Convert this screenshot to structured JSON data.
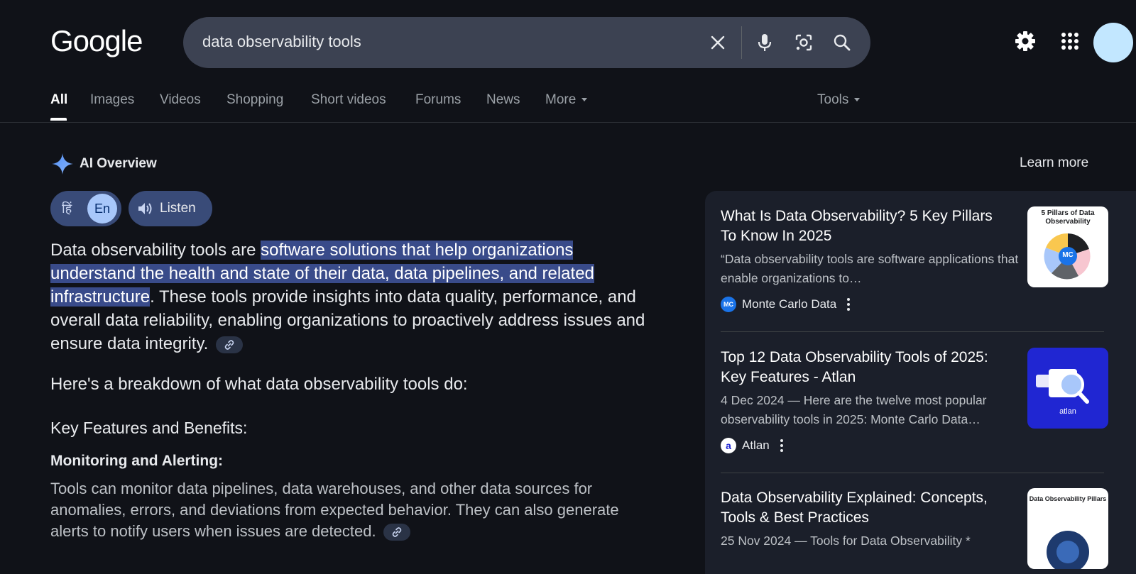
{
  "header": {
    "logo": "Google",
    "search_value": "data observability tools",
    "icons": [
      "close-icon",
      "mic-icon",
      "lens-icon",
      "search-icon",
      "gear-icon",
      "apps-grid-icon"
    ]
  },
  "tabs": [
    {
      "label": "All"
    },
    {
      "label": "Images"
    },
    {
      "label": "Videos"
    },
    {
      "label": "Shopping"
    },
    {
      "label": "Short videos"
    },
    {
      "label": "Forums"
    },
    {
      "label": "News"
    },
    {
      "label": "More"
    },
    {
      "label": "Tools"
    }
  ],
  "ai_overview": {
    "title": "AI Overview",
    "learn_more": "Learn more",
    "lang_hindi": "हिं",
    "lang_english": "En",
    "listen": "Listen",
    "intro_prefix": "Data observability tools are ",
    "intro_highlight": "software solutions that help organizations understand the health and state of their data, data pipelines, and related infrastructure",
    "intro_suffix": ". These tools provide insights into data quality, performance, and overall data reliability, enabling organizations to proactively address issues and ensure data integrity.",
    "breakdown": "Here's a breakdown of what data observability tools do:",
    "key_features_heading": "Key Features and Benefits:",
    "monitoring_heading": "Monitoring and Alerting:",
    "monitoring_body": "Tools can monitor data pipelines, data warehouses, and other data sources for anomalies, errors, and deviations from expected behavior. They can also generate alerts to notify users when issues are detected."
  },
  "sources": [
    {
      "title": "What Is Data Observability? 5 Key Pillars To Know In 2025",
      "snippet": "“Data observability tools are software applications that enable organizations to…",
      "source": "Monte Carlo Data",
      "source_icon_text": "MC",
      "thumb_text": "5 Pillars of Data Observability",
      "thumb_center": "MC"
    },
    {
      "title": "Top 12 Data Observability Tools of 2025: Key Features - Atlan",
      "snippet": "4 Dec 2024 — Here are the twelve most popular observability tools in 2025: Monte Carlo Data…",
      "source": "Atlan",
      "source_icon_text": "a",
      "thumb_text": "atlan"
    },
    {
      "title": "Data Observability Explained: Concepts, Tools & Best Practices",
      "snippet": "25 Nov 2024 — Tools for Data Observability *",
      "thumb_text": "Data Observability Pillars"
    }
  ],
  "colors": {
    "background": "#101218",
    "search_box": "#3c4252",
    "highlight": "#394b8a",
    "panel": "#1b1f2a",
    "accent_blue": "#a8c7fa"
  }
}
